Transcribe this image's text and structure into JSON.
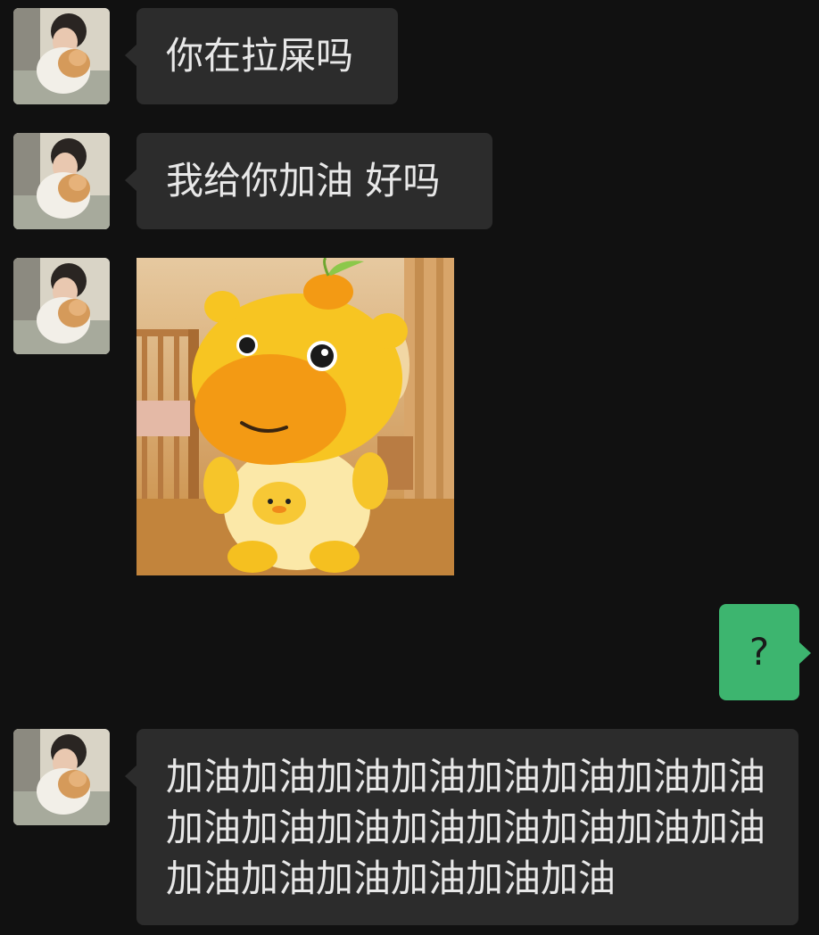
{
  "messages": [
    {
      "sender": "other",
      "type": "text",
      "text": "你在拉屎吗"
    },
    {
      "sender": "other",
      "type": "text",
      "text": "我给你加油 好吗"
    },
    {
      "sender": "other",
      "type": "sticker",
      "sticker_name": "yellow-plush-mascot-sticker"
    },
    {
      "sender": "self",
      "type": "text",
      "text": "?"
    },
    {
      "sender": "other",
      "type": "text",
      "text": "加油加油加油加油加油加油加油加油加油加油加油加油加油加油加油加油加油加油加油加油加油加油"
    }
  ],
  "colors": {
    "background": "#111111",
    "incoming_bubble": "#2c2c2c",
    "outgoing_bubble": "#3db56f",
    "incoming_text": "#e8e8e8"
  }
}
